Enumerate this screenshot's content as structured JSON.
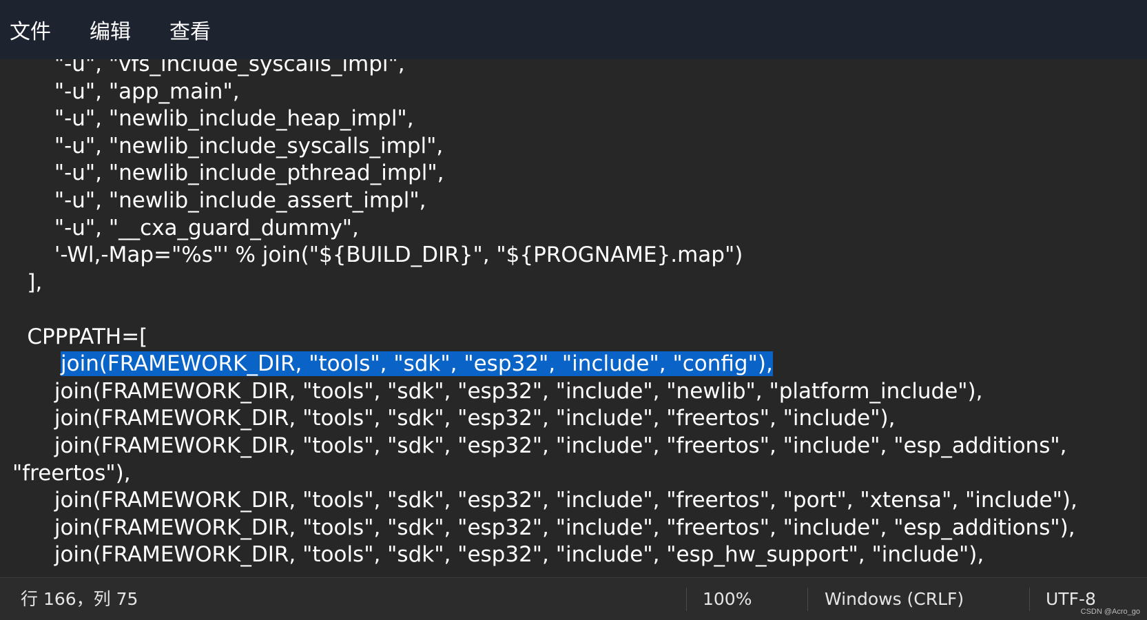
{
  "menu": {
    "items": [
      "文件",
      "编辑",
      "查看"
    ]
  },
  "editor": {
    "lines": [
      "        \"-u\", \"vfs_include_syscalls_impl\",",
      "        \"-u\", \"app_main\",",
      "        \"-u\", \"newlib_include_heap_impl\",",
      "        \"-u\", \"newlib_include_syscalls_impl\",",
      "        \"-u\", \"newlib_include_pthread_impl\",",
      "        \"-u\", \"newlib_include_assert_impl\",",
      "        \"-u\", \"__cxa_guard_dummy\",",
      "        '-Wl,-Map=\"%s\"' % join(\"${BUILD_DIR}\", \"${PROGNAME}.map\")",
      "    ],",
      "",
      "    CPPPATH=[",
      "join(FRAMEWORK_DIR, \"tools\", \"sdk\", \"esp32\", \"include\", \"config\"),",
      "        join(FRAMEWORK_DIR, \"tools\", \"sdk\", \"esp32\", \"include\", \"newlib\", \"platform_include\"),",
      "        join(FRAMEWORK_DIR, \"tools\", \"sdk\", \"esp32\", \"include\", \"freertos\", \"include\"),",
      "        join(FRAMEWORK_DIR, \"tools\", \"sdk\", \"esp32\", \"include\", \"freertos\", \"include\", \"esp_additions\",",
      "\"freertos\"),",
      "        join(FRAMEWORK_DIR, \"tools\", \"sdk\", \"esp32\", \"include\", \"freertos\", \"port\", \"xtensa\", \"include\"),",
      "        join(FRAMEWORK_DIR, \"tools\", \"sdk\", \"esp32\", \"include\", \"freertos\", \"include\", \"esp_additions\"),",
      "        join(FRAMEWORK_DIR, \"tools\", \"sdk\", \"esp32\", \"include\", \"esp_hw_support\", \"include\"),"
    ]
  },
  "status": {
    "position": "行 166，列 75",
    "zoom": "100%",
    "line_ending": "Windows (CRLF)",
    "encoding": "UTF-8"
  },
  "watermark": "CSDN @Acro_go",
  "colors": {
    "menubar_bg": "#1e2330",
    "editor_bg": "#272727",
    "selection": "#0a63c6",
    "statusbar_bg": "#2c2c2c"
  }
}
